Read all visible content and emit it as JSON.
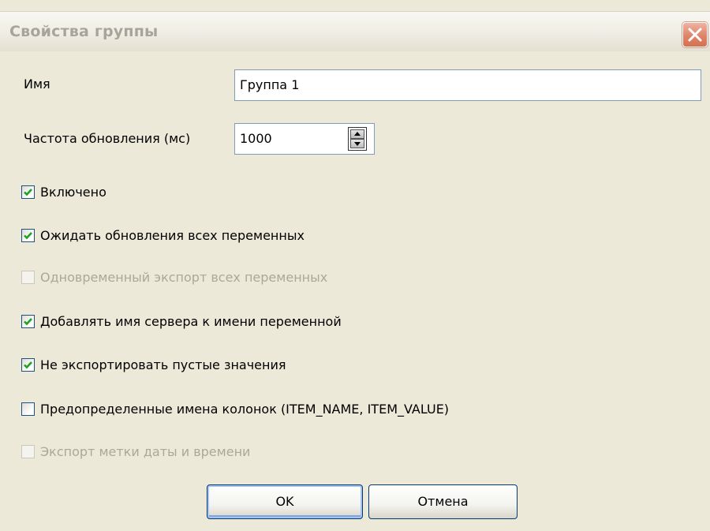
{
  "window": {
    "title": "Свойства группы"
  },
  "fields": {
    "name_label": "Имя",
    "name_value": "Группа 1",
    "rate_label": "Частота обновления (мс)",
    "rate_value": "1000"
  },
  "checkboxes": [
    {
      "label": "Включено",
      "checked": true,
      "enabled": true
    },
    {
      "label": "Ожидать обновления всех переменных",
      "checked": true,
      "enabled": true
    },
    {
      "label": "Одновременный экспорт всех переменных",
      "checked": false,
      "enabled": false
    },
    {
      "label": "Добавлять имя сервера к имени переменной",
      "checked": true,
      "enabled": true
    },
    {
      "label": "Не экспортировать пустые значения",
      "checked": true,
      "enabled": true
    },
    {
      "label": "Предопределенные имена колонок (ITEM_NAME, ITEM_VALUE)",
      "checked": false,
      "enabled": true
    },
    {
      "label": "Экспорт метки даты и времени",
      "checked": false,
      "enabled": false
    }
  ],
  "buttons": {
    "ok": "OK",
    "cancel": "Отмена"
  },
  "colors": {
    "check": "#21a121",
    "close": "#d4714f",
    "button_border": "#003c74"
  }
}
